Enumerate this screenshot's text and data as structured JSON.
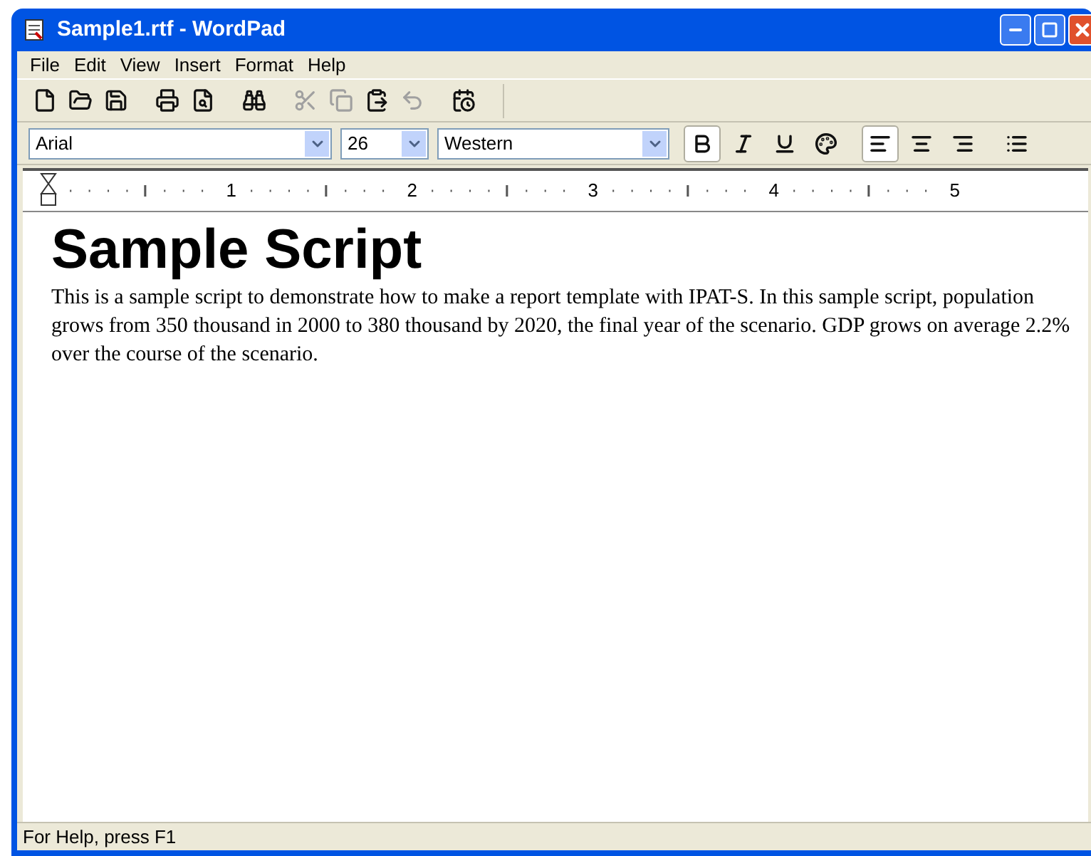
{
  "window": {
    "title": "Sample1.rtf - WordPad"
  },
  "menu": [
    "File",
    "Edit",
    "View",
    "Insert",
    "Format",
    "Help"
  ],
  "toolbar": [
    {
      "kind": "new",
      "disabled": false
    },
    {
      "kind": "open",
      "disabled": false
    },
    {
      "kind": "save",
      "disabled": false
    },
    {
      "kind": "sep"
    },
    {
      "kind": "print",
      "disabled": false
    },
    {
      "kind": "preview",
      "disabled": false
    },
    {
      "kind": "sep"
    },
    {
      "kind": "find",
      "disabled": false
    },
    {
      "kind": "sep"
    },
    {
      "kind": "cut",
      "disabled": true
    },
    {
      "kind": "copy",
      "disabled": true
    },
    {
      "kind": "paste",
      "disabled": false
    },
    {
      "kind": "undo",
      "disabled": true
    },
    {
      "kind": "sep"
    },
    {
      "kind": "datetime",
      "disabled": false
    }
  ],
  "format_bar": {
    "font": "Arial",
    "size": "26",
    "script": "Western",
    "buttons": [
      {
        "kind": "bold",
        "selected": true
      },
      {
        "kind": "italic",
        "selected": false
      },
      {
        "kind": "underline",
        "selected": false
      },
      {
        "kind": "color",
        "selected": false
      },
      {
        "kind": "sep"
      },
      {
        "kind": "left",
        "selected": true
      },
      {
        "kind": "center",
        "selected": false
      },
      {
        "kind": "right",
        "selected": false
      },
      {
        "kind": "sep"
      },
      {
        "kind": "bullets",
        "selected": false
      }
    ]
  },
  "ruler": [
    "1",
    "2",
    "3",
    "4",
    "5"
  ],
  "document": {
    "heading": "Sample Script",
    "paragraph": "This is a sample script to demonstrate how to make a report template with IPAT-S. In this sample script, population grows from 350 thousand in 2000 to 380 thousand by 2020, the final year of the scenario. GDP grows on average 2.2% over the course of the scenario."
  },
  "status_bar": "For Help, press F1"
}
